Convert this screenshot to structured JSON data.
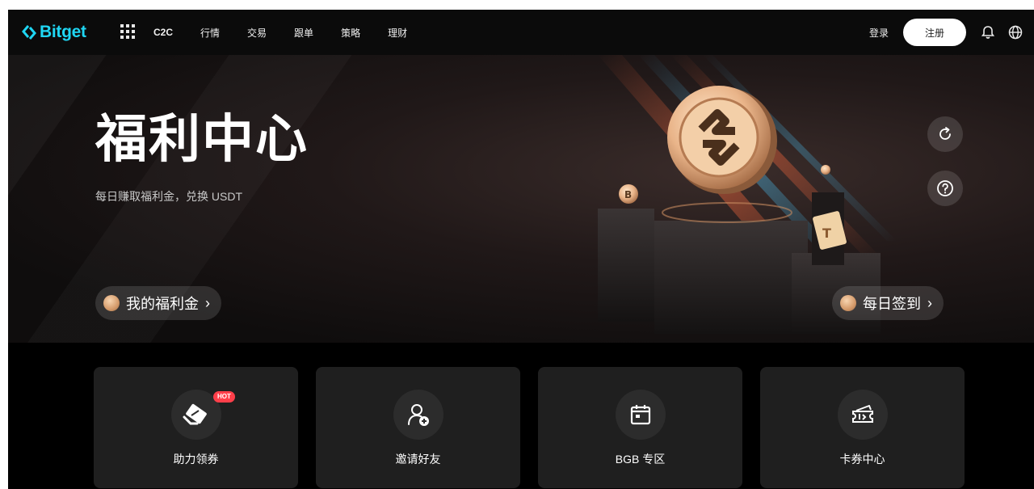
{
  "brand": {
    "name": "Bitget"
  },
  "nav": {
    "items": [
      {
        "label": "C2C"
      },
      {
        "label": "行情"
      },
      {
        "label": "交易"
      },
      {
        "label": "跟单"
      },
      {
        "label": "策略"
      },
      {
        "label": "理财"
      }
    ],
    "login_label": "登录",
    "register_label": "注册",
    "icons": [
      "apps-grid-icon",
      "bell-icon",
      "globe-icon"
    ]
  },
  "hero": {
    "title": "福利中心",
    "subtitle": "每日赚取福利金，兑换 USDT",
    "welfare_button": "我的福利金",
    "checkin_button": "每日签到",
    "chevron": "›",
    "icons": [
      "refresh-icon",
      "help-icon"
    ]
  },
  "cards": [
    {
      "label": "助力领券",
      "icon": "voucher-icon",
      "badge": "HOT"
    },
    {
      "label": "邀请好友",
      "icon": "add-user-icon"
    },
    {
      "label": "BGB 专区",
      "icon": "calendar-icon"
    },
    {
      "label": "卡券中心",
      "icon": "ticket-icon"
    }
  ],
  "colors": {
    "brand": "#1fd6f3",
    "hot_badge": "#ff3f4a",
    "card_bg": "#1f1f1f",
    "page_bg": "#000000"
  }
}
